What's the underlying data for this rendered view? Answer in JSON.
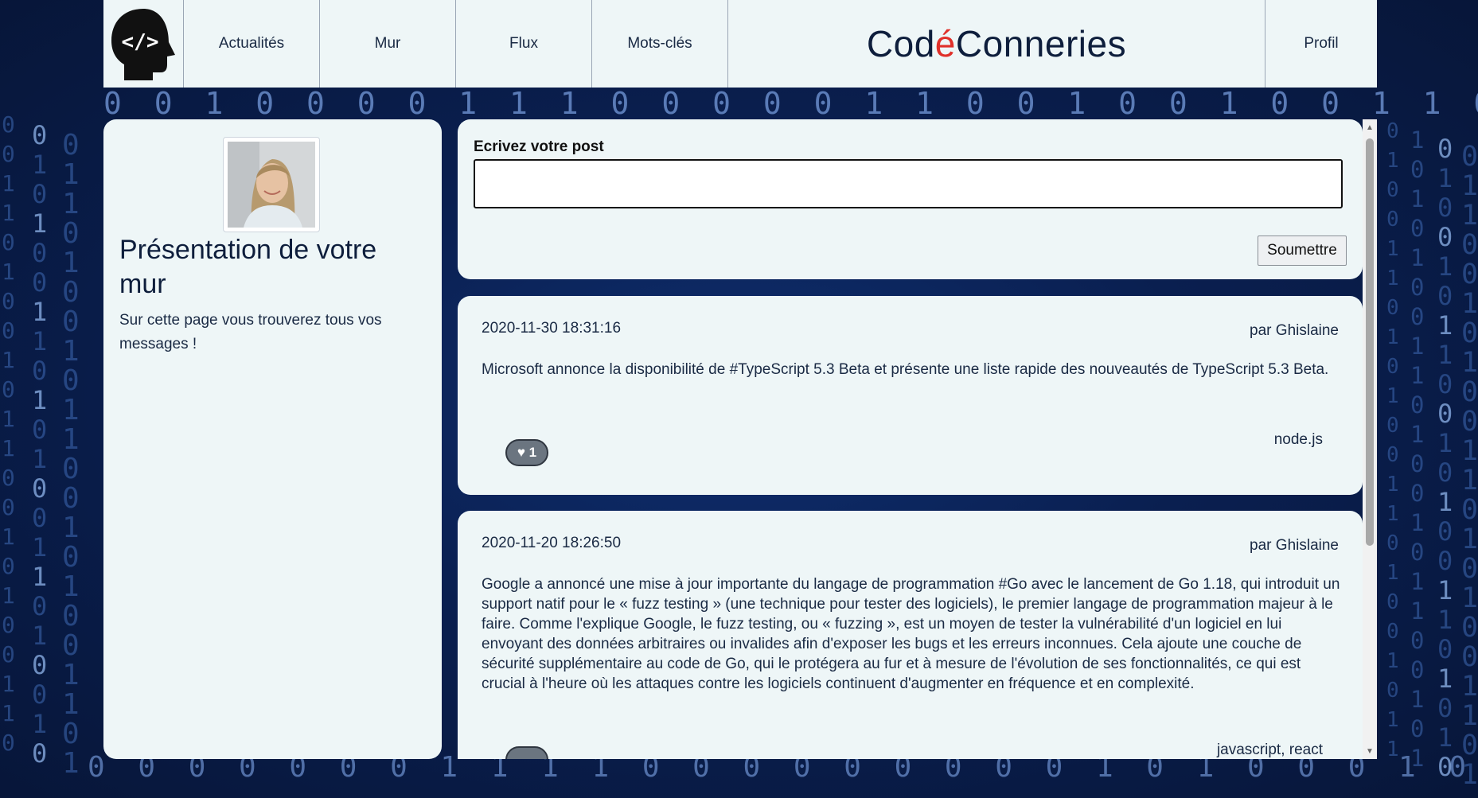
{
  "nav": {
    "items": [
      {
        "label": "Actualités"
      },
      {
        "label": "Mur"
      },
      {
        "label": "Flux"
      },
      {
        "label": "Mots-clés"
      }
    ],
    "brand": {
      "part1": "Cod",
      "accent": "é",
      "part2": "Conneries"
    },
    "profile_label": "Profil",
    "logo_icon": "head-code-icon"
  },
  "aside": {
    "title": "Présentation de votre mur",
    "text": "Sur cette page vous trouverez tous vos messages !"
  },
  "form": {
    "label": "Ecrivez votre post",
    "value": "",
    "submit_label": "Soumettre"
  },
  "posts": [
    {
      "date": "2020-11-30 18:31:16",
      "author": "par Ghislaine",
      "content": "Microsoft annonce la disponibilité de #TypeScript 5.3 Beta et présente une liste rapide des nouveautés de TypeScript 5.3 Beta.",
      "likes": "♥ 1",
      "tags": "node.js"
    },
    {
      "date": "2020-11-20 18:26:50",
      "author": "par Ghislaine",
      "content": "Google a annoncé une mise à jour importante du langage de programmation #Go avec le lancement de Go 1.18, qui introduit un support natif pour le « fuzz testing » (une technique pour tester des logiciels), le premier langage de programmation majeur à le faire. Comme l'explique Google, le fuzz testing, ou « fuzzing », est un moyen de tester la vulnérabilité d'un logiciel en lui envoyant des données arbitraires ou invalides afin d'exposer les bugs et les erreurs inconnues. Cela ajoute une couche de sécurité supplémentaire au code de Go, qui le protégera au fur et à mesure de l'évolution de ses fonctionnalités, ce qui est crucial à l'heure où les attaques contre les logiciels continuent d'augmenter en fréquence et en complexité.",
      "likes": "",
      "tags": "javascript, react"
    }
  ],
  "background": {
    "binary_top": "0 0 1 0 0 0 0 1 1 1 0 0 0 0 0 1 1 0 0 1 0 0 1 0 0 1 1 0 0 0 0 0 1 1 1 0 0 0 0",
    "binary_bottom": "0 0 0 0 0 0 0 1 1 1 1 0 0 0 0 0 0 0 0 0 1 0 1 0 0 0 1 0 0 1"
  },
  "colors": {
    "background": "#0a1f50",
    "panel": "#eef6f7",
    "brand_accent": "#e0302a",
    "text_dark": "#0e1e3c"
  }
}
